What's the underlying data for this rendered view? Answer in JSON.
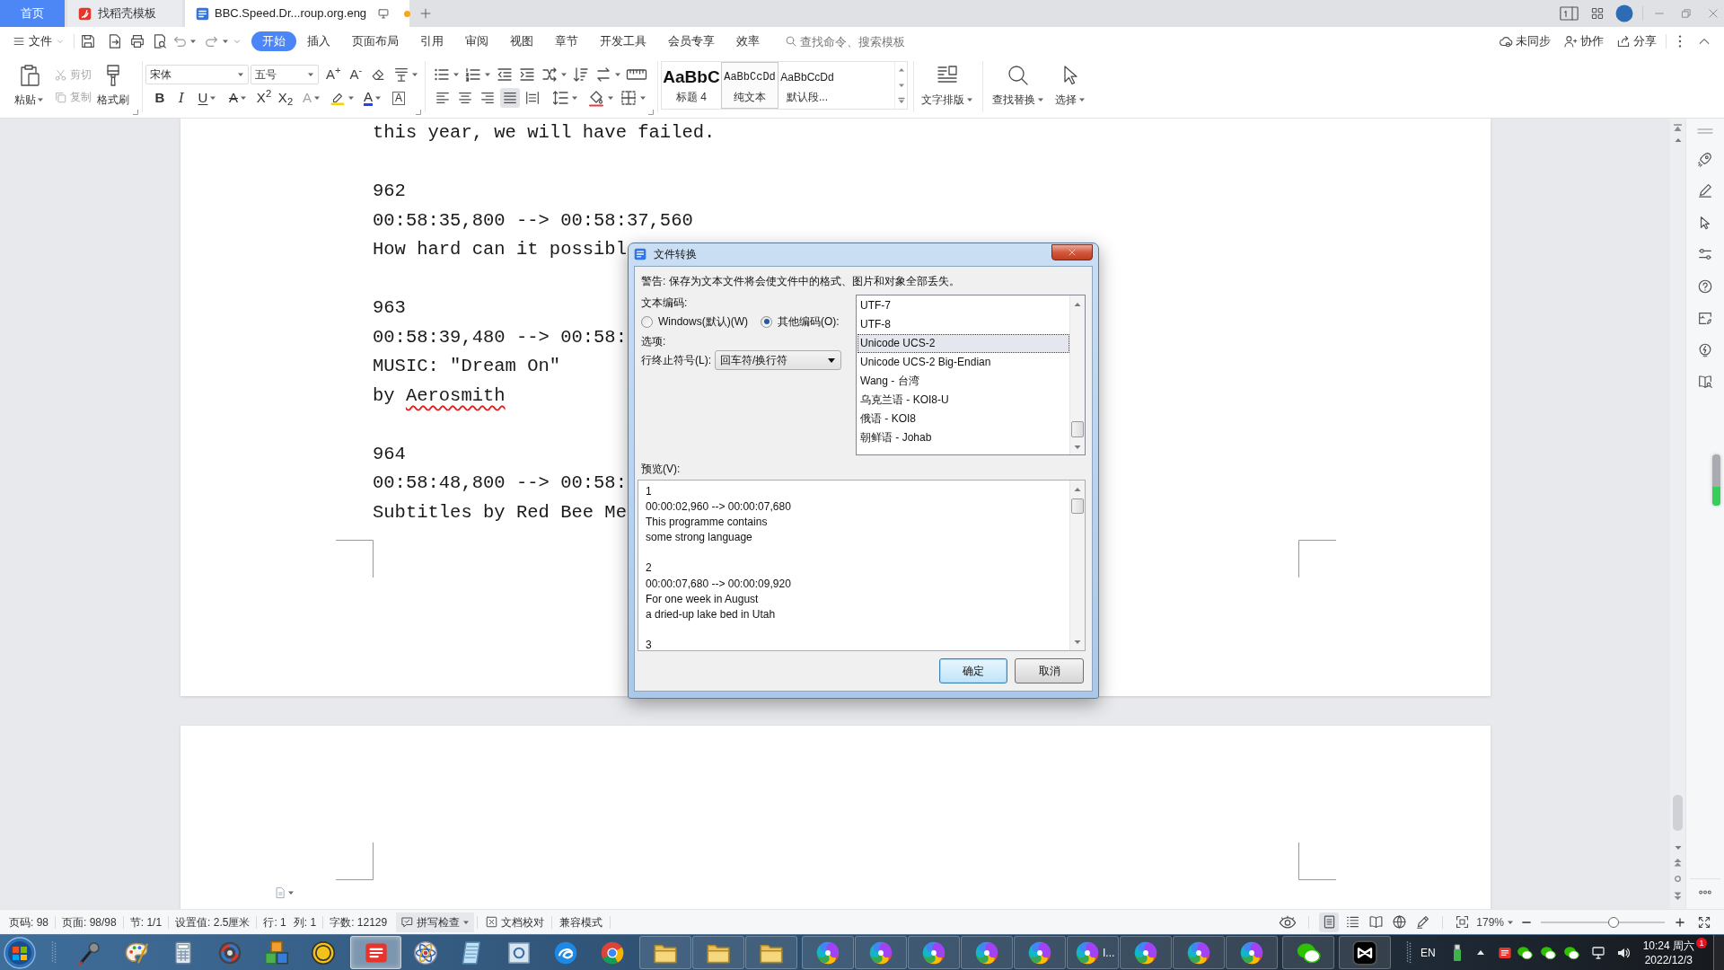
{
  "window": {
    "tabs": [
      {
        "kind": "home",
        "label": "首页",
        "selected": false
      },
      {
        "kind": "docer",
        "label": "找稻壳模板",
        "selected": false
      },
      {
        "kind": "document",
        "label": "BBC.Speed.Dr...roup.org.eng",
        "selected": true,
        "unsaved": true
      }
    ]
  },
  "menu": {
    "file": "文件",
    "items": [
      {
        "label": "开始",
        "selected": true
      },
      {
        "label": "插入",
        "selected": false
      },
      {
        "label": "页面布局",
        "selected": false
      },
      {
        "label": "引用",
        "selected": false
      },
      {
        "label": "审阅",
        "selected": false
      },
      {
        "label": "视图",
        "selected": false
      },
      {
        "label": "章节",
        "selected": false
      },
      {
        "label": "开发工具",
        "selected": false
      },
      {
        "label": "会员专享",
        "selected": false
      },
      {
        "label": "效率",
        "selected": false
      }
    ],
    "search": {
      "placeholder": "查找命令、搜索模板"
    },
    "actions": [
      {
        "kind": "sync",
        "label": "未同步"
      },
      {
        "kind": "collab",
        "label": "协作"
      },
      {
        "kind": "share",
        "label": "分享"
      }
    ]
  },
  "ribbon": {
    "clipboard": [
      {
        "kind": "paste",
        "label": "粘贴",
        "disabled": false
      },
      {
        "kind": "cut",
        "label": "剪切",
        "disabled": true
      },
      {
        "kind": "copy",
        "label": "复制",
        "disabled": true
      },
      {
        "kind": "painter",
        "label": "格式刷",
        "disabled": false
      }
    ],
    "font": {
      "name": "宋体",
      "size": "五号",
      "size_buttons": [
        {
          "kind": "grow",
          "glyph": "A$^{+}$"
        },
        {
          "kind": "shrink",
          "glyph": "A$^{-}$"
        }
      ],
      "format_buttons": [
        {
          "kind": "bold",
          "glyph": "B"
        },
        {
          "kind": "italic",
          "glyph": "I"
        },
        {
          "kind": "underline",
          "glyph": "U"
        },
        {
          "kind": "strike",
          "glyph": "A"
        },
        {
          "kind": "superscript",
          "glyph": "X$^{2}$"
        },
        {
          "kind": "subscript",
          "glyph": "X$_{2}$"
        },
        {
          "kind": "effect",
          "glyph": "A"
        },
        {
          "kind": "highlight"
        },
        {
          "kind": "color",
          "glyph": "A"
        },
        {
          "kind": "border",
          "glyph": "A"
        }
      ]
    },
    "paragraph": {
      "align_buttons": [
        {
          "kind": "left",
          "selected": false
        },
        {
          "kind": "center",
          "selected": false
        },
        {
          "kind": "right",
          "selected": false
        },
        {
          "kind": "justify",
          "selected": true
        },
        {
          "kind": "distributed",
          "selected": false
        }
      ]
    },
    "styles": [
      {
        "kind": "heading",
        "preview": "AaBbC",
        "label": "标题 4",
        "selected": false
      },
      {
        "kind": "plain",
        "preview": "AaBbCcDd",
        "label": "纯文本",
        "selected": true
      },
      {
        "kind": "default",
        "preview": "AaBbCcDd",
        "label": "默认段...",
        "selected": false
      }
    ],
    "tools": [
      {
        "kind": "layout",
        "label": "文字排版"
      },
      {
        "kind": "find",
        "label": "查找替换"
      },
      {
        "kind": "select",
        "label": "选择"
      }
    ]
  },
  "document": {
    "blocks": [
      {
        "lines": [
          {
            "text": "this year, we will have failed."
          }
        ]
      },
      {
        "lines": [
          {
            "text": "962"
          },
          {
            "text": "00:58:35,800 --> 00:58:37,560"
          },
          {
            "text": "How hard can it possibl"
          }
        ]
      },
      {
        "lines": [
          {
            "text": "963"
          },
          {
            "text": "00:58:39,480 --> 00:58:"
          },
          {
            "text": "MUSIC: ″Dream On″"
          },
          {
            "segments": [
              {
                "text": "by ",
                "misspelled": false
              },
              {
                "text": "Aerosmith",
                "misspelled": true
              }
            ]
          }
        ]
      },
      {
        "lines": [
          {
            "text": "964"
          },
          {
            "text": "00:58:48,800 --> 00:58:"
          },
          {
            "text": "Subtitles by Red Bee Me"
          }
        ]
      }
    ]
  },
  "dialog": {
    "title": "文件转换",
    "warning": "警告: 保存为文本文件将会使文件中的格式、图片和对象全部丢失。",
    "encoding_label": "文本编码:",
    "encoding_modes": [
      {
        "label": "Windows(默认)(W)",
        "selected": false
      },
      {
        "label": "其他编码(O):",
        "selected": true
      }
    ],
    "options_label": "选项:",
    "line_ending": {
      "label": "行终止符号(L):",
      "value": "回车符/换行符"
    },
    "encodings": [
      {
        "label": "UTF-7",
        "selected": false
      },
      {
        "label": "UTF-8",
        "selected": false
      },
      {
        "label": "Unicode UCS-2",
        "selected": true
      },
      {
        "label": "Unicode UCS-2 Big-Endian",
        "selected": false
      },
      {
        "label": "Wang - 台湾",
        "selected": false
      },
      {
        "label": "乌克兰语 - KOI8-U",
        "selected": false
      },
      {
        "label": "俄语 - KOI8",
        "selected": false
      },
      {
        "label": "朝鲜语 - Johab",
        "selected": false
      }
    ],
    "preview_label": "预览(V):",
    "preview": [
      [
        "1",
        "00:00:02,960 --> 00:00:07,680",
        "This programme contains",
        "some strong language"
      ],
      [
        "2",
        "00:00:07,680 --> 00:00:09,920",
        "For one week in August",
        "a dried-up lake bed in Utah"
      ],
      [
        "3"
      ]
    ],
    "buttons": [
      {
        "kind": "default",
        "label": "确定"
      },
      {
        "kind": "normal",
        "label": "取消"
      }
    ]
  },
  "status_bar": {
    "fields": [
      [
        "页码: 98"
      ],
      [
        "页面: 98/98"
      ],
      [
        "节: 1/1"
      ],
      [
        "设置值: 2.5厘米"
      ],
      [
        "行: 1",
        "列: 1"
      ],
      [
        "字数: 12129"
      ]
    ],
    "tools": [
      {
        "kind": "spell",
        "label": "拼写检查"
      },
      {
        "kind": "proof",
        "label": "文档校对"
      },
      {
        "kind": "compat",
        "label": "兼容模式"
      }
    ],
    "view_modes": [
      {
        "kind": "page",
        "selected": true
      },
      {
        "kind": "outline",
        "selected": false
      },
      {
        "kind": "reading",
        "selected": false
      },
      {
        "kind": "web",
        "selected": false
      },
      {
        "kind": "write",
        "selected": false
      }
    ],
    "zoom": {
      "value": "179%",
      "level": 0.59
    }
  },
  "taskbar": {
    "apps": [
      {
        "kind": "microphone",
        "running": false,
        "active": false
      },
      {
        "kind": "palette",
        "running": false,
        "active": false
      },
      {
        "kind": "calculator",
        "running": false,
        "active": false
      },
      {
        "kind": "disc",
        "running": false,
        "active": false
      },
      {
        "kind": "blocks",
        "running": false,
        "active": false
      },
      {
        "kind": "ue",
        "running": false,
        "active": false
      },
      {
        "kind": "wps",
        "running": true,
        "active": true
      },
      {
        "kind": "atom",
        "running": false,
        "active": false
      },
      {
        "kind": "notepad",
        "running": false,
        "active": false
      },
      {
        "kind": "r",
        "running": false,
        "active": false
      },
      {
        "kind": "swirl",
        "running": false,
        "active": false
      },
      {
        "kind": "chrome",
        "running": false,
        "active": false
      },
      {
        "kind": "folder",
        "running": true,
        "active": false
      },
      {
        "kind": "folder",
        "running": true,
        "active": false
      },
      {
        "kind": "folder",
        "running": true,
        "active": false
      },
      {
        "kind": "pinwheel",
        "running": true,
        "active": false
      },
      {
        "kind": "pinwheel",
        "running": true,
        "active": false
      },
      {
        "kind": "pinwheel",
        "running": true,
        "active": false
      },
      {
        "kind": "pinwheel",
        "running": true,
        "active": false
      },
      {
        "kind": "pinwheel",
        "running": true,
        "active": false
      },
      {
        "kind": "pinwheel",
        "running": true,
        "active": false,
        "label": "I..."
      },
      {
        "kind": "pinwheel",
        "running": true,
        "active": false
      },
      {
        "kind": "pinwheel",
        "running": true,
        "active": false
      },
      {
        "kind": "pinwheel",
        "running": true,
        "active": false
      },
      {
        "kind": "wechat",
        "running": true,
        "active": false
      },
      {
        "kind": "capcut",
        "running": true,
        "active": false
      }
    ],
    "tray": {
      "language": "EN",
      "time": "10:24 周六",
      "date": "2022/12/3",
      "badge": "1"
    }
  }
}
